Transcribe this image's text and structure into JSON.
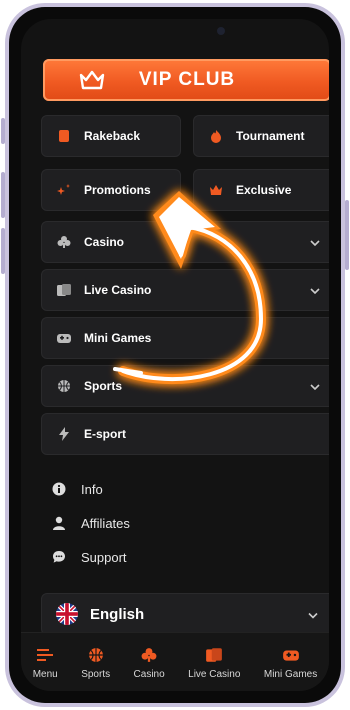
{
  "vip": {
    "label": "VIP CLUB"
  },
  "quick_tiles": [
    {
      "label": "Rakeback",
      "icon": "rakeback-icon"
    },
    {
      "label": "Tournament",
      "icon": "fire-icon"
    },
    {
      "label": "Promotions",
      "icon": "sparkle-icon"
    },
    {
      "label": "Exclusive",
      "icon": "crown-icon"
    }
  ],
  "menu": [
    {
      "label": "Casino",
      "icon": "club-icon",
      "expandable": true
    },
    {
      "label": "Live Casino",
      "icon": "cards-icon",
      "expandable": true
    },
    {
      "label": "Mini Games",
      "icon": "gamepad-icon",
      "expandable": false
    },
    {
      "label": "Sports",
      "icon": "basketball-icon",
      "expandable": true
    },
    {
      "label": "E-sport",
      "icon": "bolt-icon",
      "expandable": false
    }
  ],
  "links": [
    {
      "label": "Info",
      "icon": "info-icon"
    },
    {
      "label": "Affiliates",
      "icon": "user-icon"
    },
    {
      "label": "Support",
      "icon": "chat-icon"
    }
  ],
  "language": {
    "label": "English",
    "icon": "uk-flag-icon"
  },
  "bottom_nav": [
    {
      "label": "Menu",
      "icon": "menu-icon"
    },
    {
      "label": "Sports",
      "icon": "basketball-icon"
    },
    {
      "label": "Casino",
      "icon": "club-icon"
    },
    {
      "label": "Live Casino",
      "icon": "cards-icon"
    },
    {
      "label": "Mini Games",
      "icon": "gamepad-icon"
    }
  ],
  "colors": {
    "accent": "#f05a22",
    "annotation_glow": "#ff8a1a",
    "background": "#131313",
    "tile": "#1f1f21"
  }
}
